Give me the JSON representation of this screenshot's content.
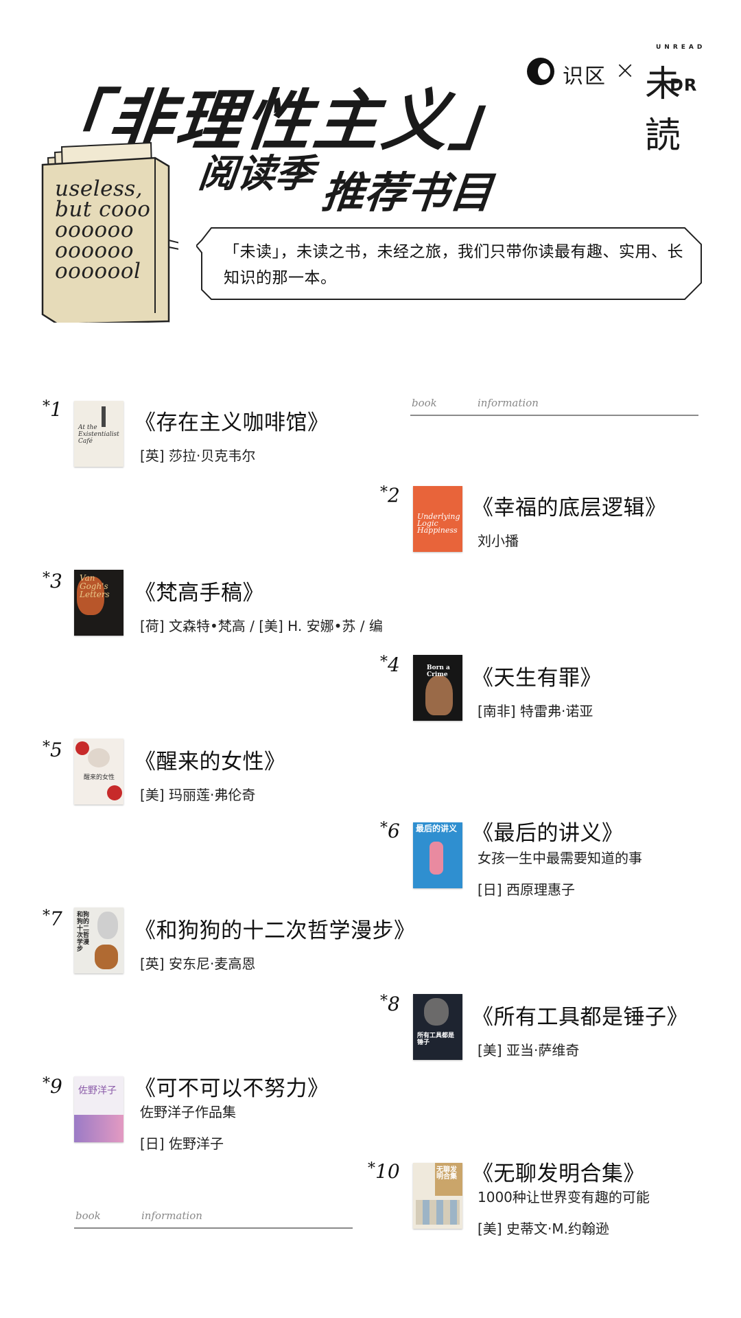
{
  "header": {
    "logo_left_text": "识区",
    "logo_cross": "×",
    "logo_right_small": "UNREAD",
    "logo_right_main": "未読",
    "logo_right_dr": "DR",
    "title": "「非理性主义」",
    "subtitle_part1": "阅读季",
    "subtitle_part2": "推荐书目"
  },
  "illustration": {
    "book_lines": [
      "useless,",
      "but cooo",
      "oooooo",
      "oooooo",
      "ooooool"
    ]
  },
  "intro": "「未读」，未读之书，未经之旅，我们只带你读最有趣、实用、长知识的那一本。",
  "info_labels": {
    "left": "book",
    "right": "information"
  },
  "books": [
    {
      "num": "1",
      "title": "《存在主义咖啡馆》",
      "subtitle": "",
      "author": "[英] 莎拉·贝克韦尔",
      "cover_color": "#f1ede4",
      "cover_text": "At the Existentialist Café"
    },
    {
      "num": "2",
      "title": "《幸福的底层逻辑》",
      "subtitle": "",
      "author": "刘小播",
      "cover_color": "#e8643a",
      "cover_text": "Underlying Logic Happiness"
    },
    {
      "num": "3",
      "title": "《梵高手稿》",
      "subtitle": "",
      "author": "[荷] 文森特•梵高 / [美] H. 安娜•苏 / 编",
      "cover_color": "#1c1a18",
      "cover_text": "Van Gogh's Letters"
    },
    {
      "num": "4",
      "title": "《天生有罪》",
      "subtitle": "",
      "author": "[南非] 特雷弗·诺亚",
      "cover_color": "#161616",
      "cover_text": "Born a Crime"
    },
    {
      "num": "5",
      "title": "《醒来的女性》",
      "subtitle": "",
      "author": "[美] 玛丽莲·弗伦奇",
      "cover_color": "#f3eee8",
      "cover_text": "醒来的女性"
    },
    {
      "num": "6",
      "title": "《最后的讲义》",
      "subtitle": "女孩一生中最需要知道的事",
      "author": "[日] 西原理惠子",
      "cover_color": "#2f8fd0",
      "cover_text": "最后的讲义"
    },
    {
      "num": "7",
      "title": "《和狗狗的十二次哲学漫步》",
      "subtitle": "",
      "author": "[英] 安东尼·麦高恩",
      "cover_color": "#ecebe6",
      "cover_text": "和狗狗的十二次哲学漫步"
    },
    {
      "num": "8",
      "title": "《所有工具都是锤子》",
      "subtitle": "",
      "author": "[美] 亚当·萨维奇",
      "cover_color": "#1e2430",
      "cover_text": "所有工具都是锤子"
    },
    {
      "num": "9",
      "title": "《可不可以不努力》",
      "subtitle": "佐野洋子作品集",
      "author": "[日] 佐野洋子",
      "cover_color": "#d9c2d8",
      "cover_text": "佐野洋子"
    },
    {
      "num": "10",
      "title": "《无聊发明合集》",
      "subtitle": "1000种让世界变有趣的可能",
      "author": "[美] 史蒂文·M.约翰逊",
      "cover_color": "#caa56a",
      "cover_text": "无聊发明合集"
    }
  ]
}
